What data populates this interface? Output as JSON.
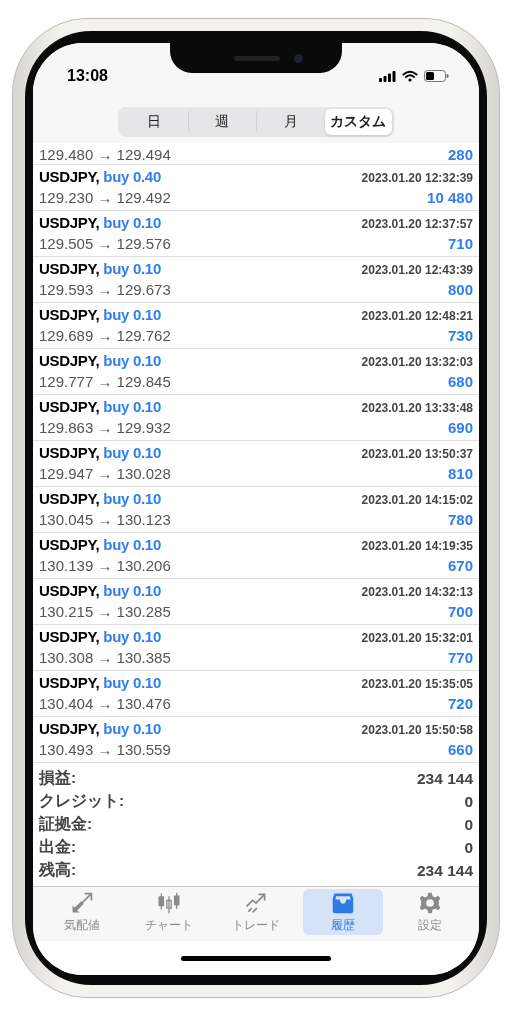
{
  "status_bar": {
    "time": "13:08"
  },
  "segments": [
    {
      "label": "日",
      "selected": false
    },
    {
      "label": "週",
      "selected": false
    },
    {
      "label": "月",
      "selected": false
    },
    {
      "label": "カスタム",
      "selected": true
    }
  ],
  "trades": [
    {
      "prices": "129.480 → 129.494",
      "profit": "280"
    },
    {
      "symbol": "USDJPY,",
      "order": "buy 0.40",
      "time": "2023.01.20 12:32:39",
      "prices": "129.230 → 129.492",
      "profit": "10 480"
    },
    {
      "symbol": "USDJPY,",
      "order": "buy 0.10",
      "time": "2023.01.20 12:37:57",
      "prices": "129.505 → 129.576",
      "profit": "710"
    },
    {
      "symbol": "USDJPY,",
      "order": "buy 0.10",
      "time": "2023.01.20 12:43:39",
      "prices": "129.593 → 129.673",
      "profit": "800"
    },
    {
      "symbol": "USDJPY,",
      "order": "buy 0.10",
      "time": "2023.01.20 12:48:21",
      "prices": "129.689 → 129.762",
      "profit": "730"
    },
    {
      "symbol": "USDJPY,",
      "order": "buy 0.10",
      "time": "2023.01.20 13:32:03",
      "prices": "129.777 → 129.845",
      "profit": "680"
    },
    {
      "symbol": "USDJPY,",
      "order": "buy 0.10",
      "time": "2023.01.20 13:33:48",
      "prices": "129.863 → 129.932",
      "profit": "690"
    },
    {
      "symbol": "USDJPY,",
      "order": "buy 0.10",
      "time": "2023.01.20 13:50:37",
      "prices": "129.947 → 130.028",
      "profit": "810"
    },
    {
      "symbol": "USDJPY,",
      "order": "buy 0.10",
      "time": "2023.01.20 14:15:02",
      "prices": "130.045 → 130.123",
      "profit": "780"
    },
    {
      "symbol": "USDJPY,",
      "order": "buy 0.10",
      "time": "2023.01.20 14:19:35",
      "prices": "130.139 → 130.206",
      "profit": "670"
    },
    {
      "symbol": "USDJPY,",
      "order": "buy 0.10",
      "time": "2023.01.20 14:32:13",
      "prices": "130.215 → 130.285",
      "profit": "700"
    },
    {
      "symbol": "USDJPY,",
      "order": "buy 0.10",
      "time": "2023.01.20 15:32:01",
      "prices": "130.308 → 130.385",
      "profit": "770"
    },
    {
      "symbol": "USDJPY,",
      "order": "buy 0.10",
      "time": "2023.01.20 15:35:05",
      "prices": "130.404 → 130.476",
      "profit": "720"
    },
    {
      "symbol": "USDJPY,",
      "order": "buy 0.10",
      "time": "2023.01.20 15:50:58",
      "prices": "130.493 → 130.559",
      "profit": "660"
    }
  ],
  "summary": [
    {
      "label": "損益:",
      "value": "234 144"
    },
    {
      "label": "クレジット:",
      "value": "0"
    },
    {
      "label": "証拠金:",
      "value": "0"
    },
    {
      "label": "出金:",
      "value": "0"
    },
    {
      "label": "残高:",
      "value": "234 144"
    }
  ],
  "tab_bar": [
    {
      "kind": "quotes",
      "label": "気配値",
      "selected": false
    },
    {
      "kind": "chart",
      "label": "チャート",
      "selected": false
    },
    {
      "kind": "trade",
      "label": "トレード",
      "selected": false
    },
    {
      "kind": "history",
      "label": "履歴",
      "selected": true
    },
    {
      "kind": "settings",
      "label": "設定",
      "selected": false
    }
  ]
}
